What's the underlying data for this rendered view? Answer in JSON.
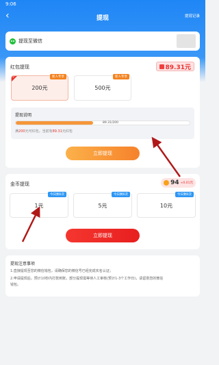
{
  "status_bar": {
    "time": "9:06"
  },
  "nav": {
    "title": "提现",
    "record_label": "提现记录"
  },
  "wechat": {
    "label": "提现至微信"
  },
  "redpack": {
    "title": "红包提现",
    "balance": "89.31元",
    "options": [
      {
        "amount": "200元",
        "tag": "新人专享",
        "selected": true
      },
      {
        "amount": "500元",
        "tag": "新人专享",
        "selected": false
      }
    ],
    "explain": {
      "title": "提现说明",
      "progress_text": "89.31/200",
      "progress_fraction": 0.4466,
      "desc_prefix": "满",
      "desc_amount": "200",
      "desc_mid": "元可红包，当前有",
      "desc_current": "89.31",
      "desc_suffix": "元红包"
    },
    "button_label": "立即提现"
  },
  "coin": {
    "title": "金币提现",
    "balance": "94",
    "balance_sub": "≈0.01元",
    "options": [
      {
        "amount": "1元",
        "tag": "今日剩0次"
      },
      {
        "amount": "5元",
        "tag": "今日剩0次"
      },
      {
        "amount": "10元",
        "tag": "今日剩0次"
      }
    ],
    "button_label": "立即提现"
  },
  "notice": {
    "title": "提现注意事项",
    "lines": [
      "1.直接提现至您的微信钱包，请确保您的微信号已经完成实名认证；",
      "2.申请提现后，预计10秒内打款到账，部分提现需等待人工审核(预计1-3个工作日)，请留意您的微信",
      "钱包。"
    ]
  },
  "colors": {
    "header_blue": "#1f86f6",
    "accent_red": "#e8312f",
    "accent_orange": "#f6822b",
    "coin_tag_blue": "#2d97f5"
  }
}
